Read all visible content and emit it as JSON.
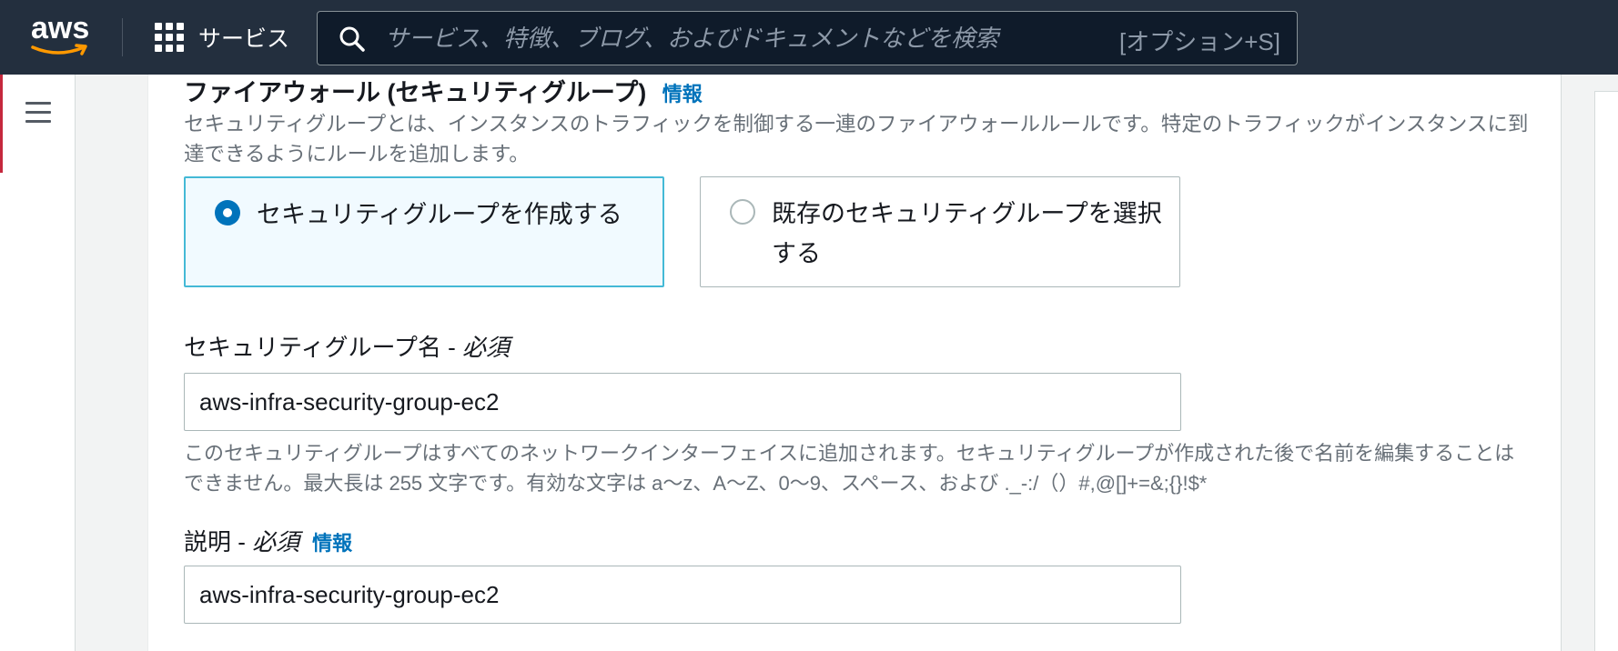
{
  "nav": {
    "logo_text": "aws",
    "services_label": "サービス",
    "search_placeholder": "サービス、特徴、ブログ、およびドキュメントなどを検索",
    "search_shortcut": "[オプション+S]"
  },
  "section": {
    "title": "ファイアウォール (セキュリティグループ)",
    "info_label": "情報",
    "description": "セキュリティグループとは、インスタンスのトラフィックを制御する一連のファイアウォールルールです。特定のトラフィックがインスタンスに到達できるようにルールを追加します。"
  },
  "options": [
    {
      "label": "セキュリティグループを作成する",
      "selected": true
    },
    {
      "label": "既存のセキュリティグループを選択する",
      "selected": false
    }
  ],
  "name_field": {
    "label": "セキュリティグループ名 - ",
    "required": "必須",
    "value": "aws-infra-security-group-ec2",
    "hint": "このセキュリティグループはすべてのネットワークインターフェイスに追加されます。セキュリティグループが作成された後で名前を編集することはできません。最大長は 255 文字です。有効な文字は a〜z、A〜Z、0〜9、スペース、および ._-:/（）#,@[]+=&;{}!$*"
  },
  "description_field": {
    "label": "説明 - ",
    "required": "必須",
    "info_label": "情報",
    "value": "aws-infra-security-group-ec2"
  },
  "colors": {
    "nav_bg": "#232f3e",
    "link": "#0073bb",
    "selected_tile_bg": "#f1faff",
    "selected_tile_border": "#44b9d6",
    "aws_orange": "#ff9900"
  }
}
